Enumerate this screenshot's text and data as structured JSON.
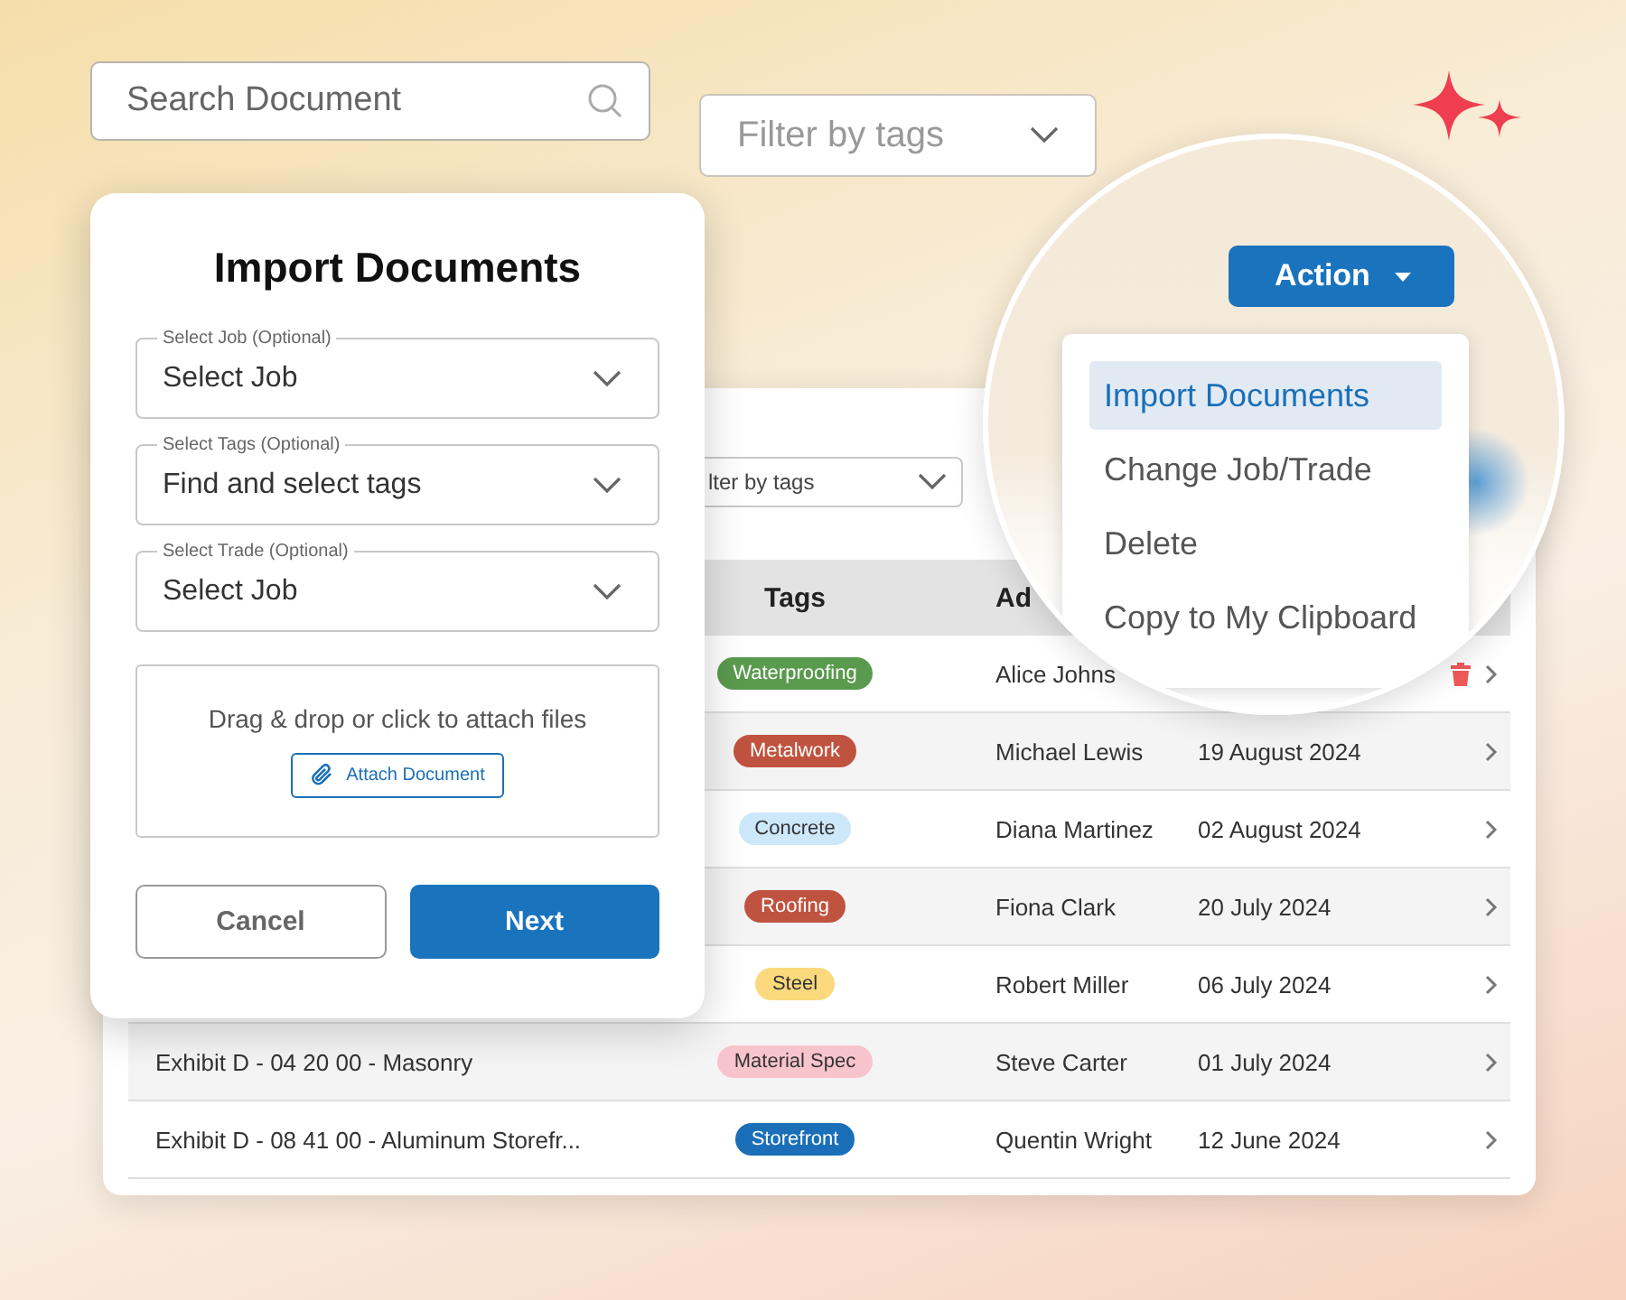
{
  "search": {
    "placeholder": "Search Document"
  },
  "tag_filter": {
    "placeholder": "Filter by tags"
  },
  "table_card": {
    "tag_filter": {
      "placeholder": "lter by tags"
    },
    "columns": [
      "Tags",
      "Ad"
    ],
    "rows": [
      {
        "tag": {
          "label": "Waterproofing",
          "color": "#5a9a4e"
        },
        "added_by": "Alice Johns",
        "delete_icon": true
      },
      {
        "tag": {
          "label": "Metalwork",
          "color": "#c0533f"
        },
        "added_by": "Michael Lewis",
        "date": "19 August 2024"
      },
      {
        "tag": {
          "label": "Concrete",
          "color": "#cde7fb"
        },
        "added_by": "Diana Martinez",
        "date": "02 August 2024"
      },
      {
        "tag": {
          "label": "Roofing",
          "color": "#c0533f"
        },
        "added_by": "Fiona Clark",
        "date": "20 July 2024"
      },
      {
        "tag": {
          "label": "Steel",
          "color": "#fbd97c"
        },
        "added_by": "Robert Miller",
        "date": "06 July 2024"
      },
      {
        "document": "Exhibit D - 04 20 00 - Masonry",
        "tag": {
          "label": "Material Spec",
          "color": "#f8c4cc"
        },
        "added_by": "Steve Carter",
        "date": "01 July 2024"
      },
      {
        "document": "Exhibit D - 08 41 00 -  Aluminum Storefr...",
        "tag": {
          "label": "Storefront",
          "color": "#1a6fb8"
        },
        "added_by": "Quentin Wright",
        "date": "12 June 2024"
      }
    ]
  },
  "import_dialog": {
    "title": "Import Documents",
    "fields": [
      {
        "label": "Select Job (Optional)",
        "value": "Select Job"
      },
      {
        "label": "Select Tags (Optional)",
        "value": "Find and select tags"
      },
      {
        "label": "Select Trade (Optional)",
        "value": "Select Job"
      }
    ],
    "drop_zone": {
      "text": "Drag & drop or click to attach files",
      "button": "Attach Document"
    },
    "buttons": [
      {
        "label": "Cancel",
        "kind": "secondary"
      },
      {
        "label": "Next",
        "kind": "primary"
      }
    ]
  },
  "action_menu": {
    "button": "Action",
    "items": [
      {
        "label": "Import Documents",
        "selected": true
      },
      {
        "label": "Change Job/Trade",
        "selected": false
      },
      {
        "label": "Delete",
        "selected": false
      },
      {
        "label": "Copy to My Clipboard",
        "selected": false
      }
    ]
  }
}
